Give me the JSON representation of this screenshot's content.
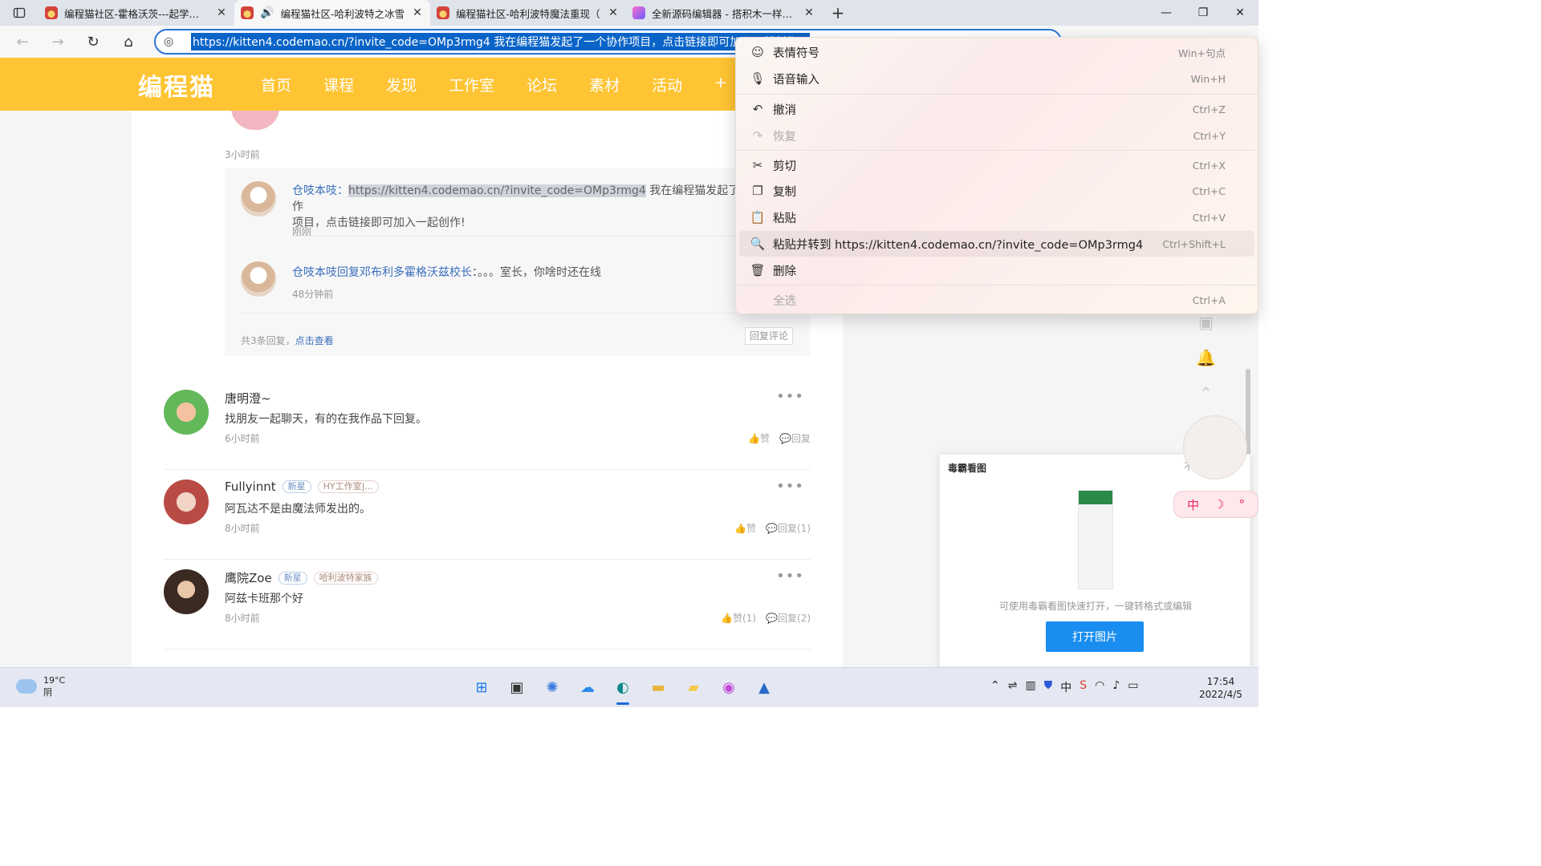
{
  "browser": {
    "tabs": [
      {
        "title": "编程猫社区-霍格沃茨---起学编程",
        "active": false
      },
      {
        "title": "编程猫社区-哈利波特之冰雪",
        "active": true
      },
      {
        "title": "编程猫社区-哈利波特魔法重现（",
        "active": false
      },
      {
        "title": "全新源码编辑器 - 搭积木一样有趣",
        "active": false
      }
    ],
    "url": "https://kitten4.codemao.cn/?invite_code=OMp3rmg4 我在编程猫发起了一个协作项目，点击链接即可加入一起创作！"
  },
  "site": {
    "logo": "编程猫",
    "nav": [
      "首页",
      "课程",
      "发现",
      "工作室",
      "论坛",
      "素材",
      "活动",
      "+"
    ]
  },
  "thread": {
    "top_time": "3小时前",
    "replies": [
      {
        "name": "仓吱本吱",
        "link": "https://kitten4.codemao.cn/?invite_code=OMp3rmg4",
        "text_a": " 我在编程猫发起了一个协作",
        "text_b": "项目，点击链接即可加入一起创作!",
        "time": "刚刚"
      },
      {
        "name": "仓吱本吱回复邓布利多霍格沃兹校长",
        "text": "：。。。室长，你啥时还在线",
        "time": "48分钟前"
      }
    ],
    "footer_count": "共3条回复，",
    "footer_link": "点击查看",
    "reply_button": "回复评论"
  },
  "comments": [
    {
      "name": "唐明澄~",
      "badges": [],
      "text": "找朋友一起聊天，有的在我作品下回复。",
      "time": "6小时前",
      "like": "赞",
      "reply": "回复"
    },
    {
      "name": "Fullyinnt",
      "badges": [
        "新星",
        "HY工作室|..."
      ],
      "text": "阿瓦达不是由魔法师发出的。",
      "time": "8小时前",
      "like": "赞",
      "reply": "回复(1)"
    },
    {
      "name": "鹰院Zoe",
      "badges": [
        "新星",
        "哈利波特家族"
      ],
      "text": "阿兹卡班那个好",
      "time": "8小时前",
      "like": "赞(1)",
      "reply": "回复(2)"
    }
  ],
  "context_menu": {
    "items": [
      {
        "icon": "emoji-icon",
        "glyph": "☺",
        "label": "表情符号",
        "shortcut": "Win+句点",
        "enabled": true
      },
      {
        "icon": "mic-icon",
        "glyph": "🎙",
        "label": "语音输入",
        "shortcut": "Win+H",
        "enabled": true
      },
      {
        "icon": "undo-icon",
        "glyph": "↶",
        "label": "撤消",
        "shortcut": "Ctrl+Z",
        "enabled": true
      },
      {
        "icon": "redo-icon",
        "glyph": "↷",
        "label": "恢复",
        "shortcut": "Ctrl+Y",
        "enabled": false
      },
      {
        "icon": "cut-icon",
        "glyph": "✂",
        "label": "剪切",
        "shortcut": "Ctrl+X",
        "enabled": true
      },
      {
        "icon": "copy-icon",
        "glyph": "❐",
        "label": "复制",
        "shortcut": "Ctrl+C",
        "enabled": true
      },
      {
        "icon": "paste-icon",
        "glyph": "📋",
        "label": "粘贴",
        "shortcut": "Ctrl+V",
        "enabled": true
      },
      {
        "icon": "paste-go-icon",
        "glyph": "🔍",
        "label": "粘贴并转到 https://kitten4.codemao.cn/?invite_code=OMp3rmg4",
        "shortcut": "Ctrl+Shift+L",
        "enabled": true
      },
      {
        "icon": "delete-icon",
        "glyph": "🗑",
        "label": "删除",
        "shortcut": "",
        "enabled": true
      },
      {
        "icon": "select-all-icon",
        "glyph": "",
        "label": "全选",
        "shortcut": "Ctrl+A",
        "enabled": false
      }
    ]
  },
  "viewer": {
    "title": "毒霸看图",
    "hint": "可使用毒霸看图快速打开，一键转格式或编辑",
    "button": "打开图片",
    "close": "不"
  },
  "mascot": {
    "label_left": "中",
    "label_mid": "☽",
    "label_right": "°"
  },
  "taskbar": {
    "temp": "19°C",
    "weather": "阴",
    "time": "17:54",
    "date": "2022/4/5"
  }
}
